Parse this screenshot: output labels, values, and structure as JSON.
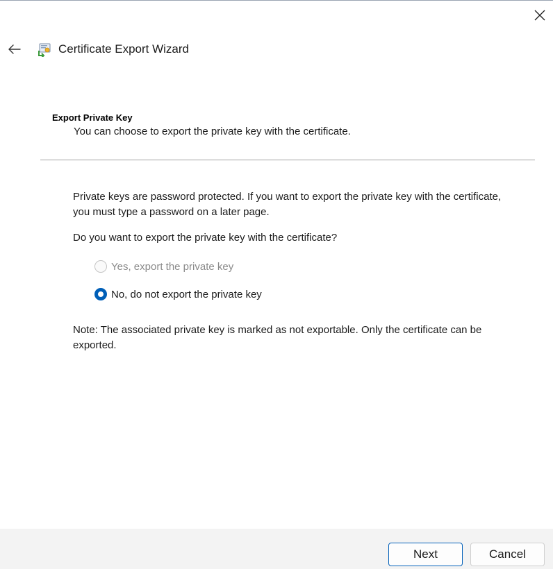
{
  "window": {
    "title": "Certificate Export Wizard",
    "close_icon": "close-icon",
    "back_icon": "back-arrow-icon",
    "wizard_icon": "certificate-icon"
  },
  "section": {
    "heading": "Export Private Key",
    "subheading": "You can choose to export the private key with the certificate."
  },
  "content": {
    "paragraph1": "Private keys are password protected. If you want to export the private key with the certificate, you must type a password on a later page.",
    "question": "Do you want to export the private key with the certificate?",
    "options": [
      {
        "label": "Yes, export the private key",
        "selected": false,
        "enabled": false
      },
      {
        "label": "No, do not export the private key",
        "selected": true,
        "enabled": true
      }
    ],
    "note": "Note: The associated private key is marked as not exportable. Only the certificate can be exported."
  },
  "footer": {
    "next_label": "Next",
    "cancel_label": "Cancel"
  },
  "colors": {
    "accent": "#005fb8",
    "footer_bg": "#f3f3f3",
    "disabled_text": "#8a8a8a"
  }
}
